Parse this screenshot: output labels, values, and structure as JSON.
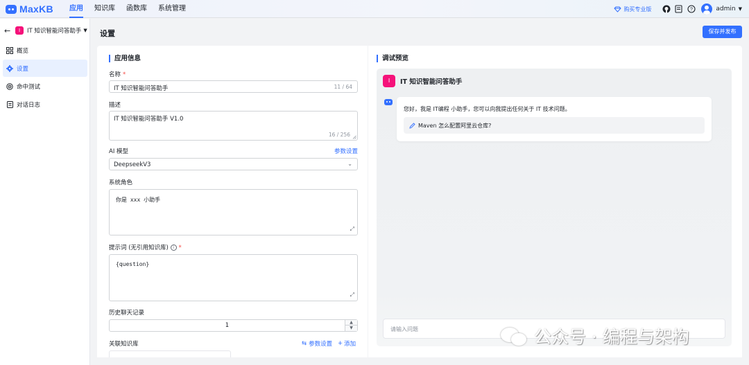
{
  "header": {
    "logo_text": "MaxKB",
    "nav": [
      "应用",
      "知识库",
      "函数库",
      "系统管理"
    ],
    "buy_pro": "购买专业版",
    "user": "admin",
    "icons": [
      "gem-icon",
      "github-icon",
      "document-icon",
      "help-icon",
      "avatar-icon"
    ]
  },
  "sidebar": {
    "app_tile": "I",
    "app_name": "IT 知识智能问答助手",
    "items": [
      {
        "label": "概览",
        "icon": "grid-icon"
      },
      {
        "label": "设置",
        "icon": "gear-icon"
      },
      {
        "label": "命中测试",
        "icon": "target-icon"
      },
      {
        "label": "对话日志",
        "icon": "log-icon"
      }
    ]
  },
  "page": {
    "title": "设置",
    "publish_button": "保存并发布"
  },
  "form": {
    "section_title": "应用信息",
    "name_label": "名称",
    "required_mark": "*",
    "name_value": "IT 知识智能问答助手",
    "name_count": "11 / 64",
    "desc_label": "描述",
    "desc_value": "IT 知识智能问答助手 V1.0",
    "desc_count": "16 / 256",
    "model_label": "AI 模型",
    "param_settings": "参数设置",
    "model_value": "DeepseekV3",
    "role_label": "系统角色",
    "role_value": "你是 xxx 小助手",
    "prompt_label": "提示词 (无引用知识库)",
    "prompt_value": "{question}",
    "history_label": "历史聊天记录",
    "history_value": "1",
    "kb_label": "关联知识库",
    "kb_param_settings": "参数设置",
    "kb_add": "添加"
  },
  "preview": {
    "section_title": "调试预览",
    "tile": "I",
    "app_name": "IT 知识智能问答助手",
    "greeting": "您好，我是 IT编程 小助手，您可以向我提出任何关于 IT 技术问题。",
    "suggestion": "Maven 怎么配置阿里云仓库?",
    "input_placeholder": "请输入问题"
  },
  "watermark": "公众号 · 编程与架构",
  "colors": {
    "accent": "#3370ff",
    "app_tile": "#f5127a",
    "required": "#f54a45"
  }
}
